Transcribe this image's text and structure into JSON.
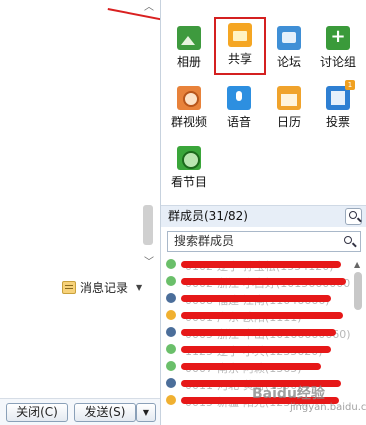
{
  "apps": [
    {
      "label": "相册",
      "icon": "photo-album-icon"
    },
    {
      "label": "共享",
      "icon": "share-folder-icon"
    },
    {
      "label": "论坛",
      "icon": "forum-icon"
    },
    {
      "label": "讨论组",
      "icon": "discussion-group-icon"
    },
    {
      "label": "群视频",
      "icon": "group-video-icon"
    },
    {
      "label": "语音",
      "icon": "voice-icon"
    },
    {
      "label": "日历",
      "icon": "calendar-icon"
    },
    {
      "label": "投票",
      "icon": "vote-icon",
      "badge": "1"
    },
    {
      "label": "看节目",
      "icon": "watch-show-icon"
    }
  ],
  "members": {
    "header": "群成员(31/82)",
    "search_placeholder": "搜索群成员",
    "items": [
      {
        "text": "0102-辽宁-孙宝松(1554120)"
      },
      {
        "text": "0002-浙江-小白好(1015660000)"
      },
      {
        "text": "0008-福建-江南(11046666)"
      },
      {
        "text": "0001-广东-欧阳(1111)"
      },
      {
        "text": "0005-浙江-中山(10166660660)"
      },
      {
        "text": "1125-辽宁-小兵(1235620)"
      },
      {
        "text": "0007-南京-阿赖(1365)"
      },
      {
        "text": "0011-河北-黄哥(13900)"
      },
      {
        "text": "0015-新疆-阳光(12356)"
      }
    ]
  },
  "left": {
    "message_log": "消息记录",
    "close_button": "关闭(C)",
    "send_button": "发送(S)"
  },
  "watermark": {
    "main": "Baidu经验",
    "sub": "jingyan.baidu.com"
  },
  "colors": {
    "highlight_box": "#d42020",
    "scribble": "#e61818",
    "header_bg": "#e7eef7"
  }
}
